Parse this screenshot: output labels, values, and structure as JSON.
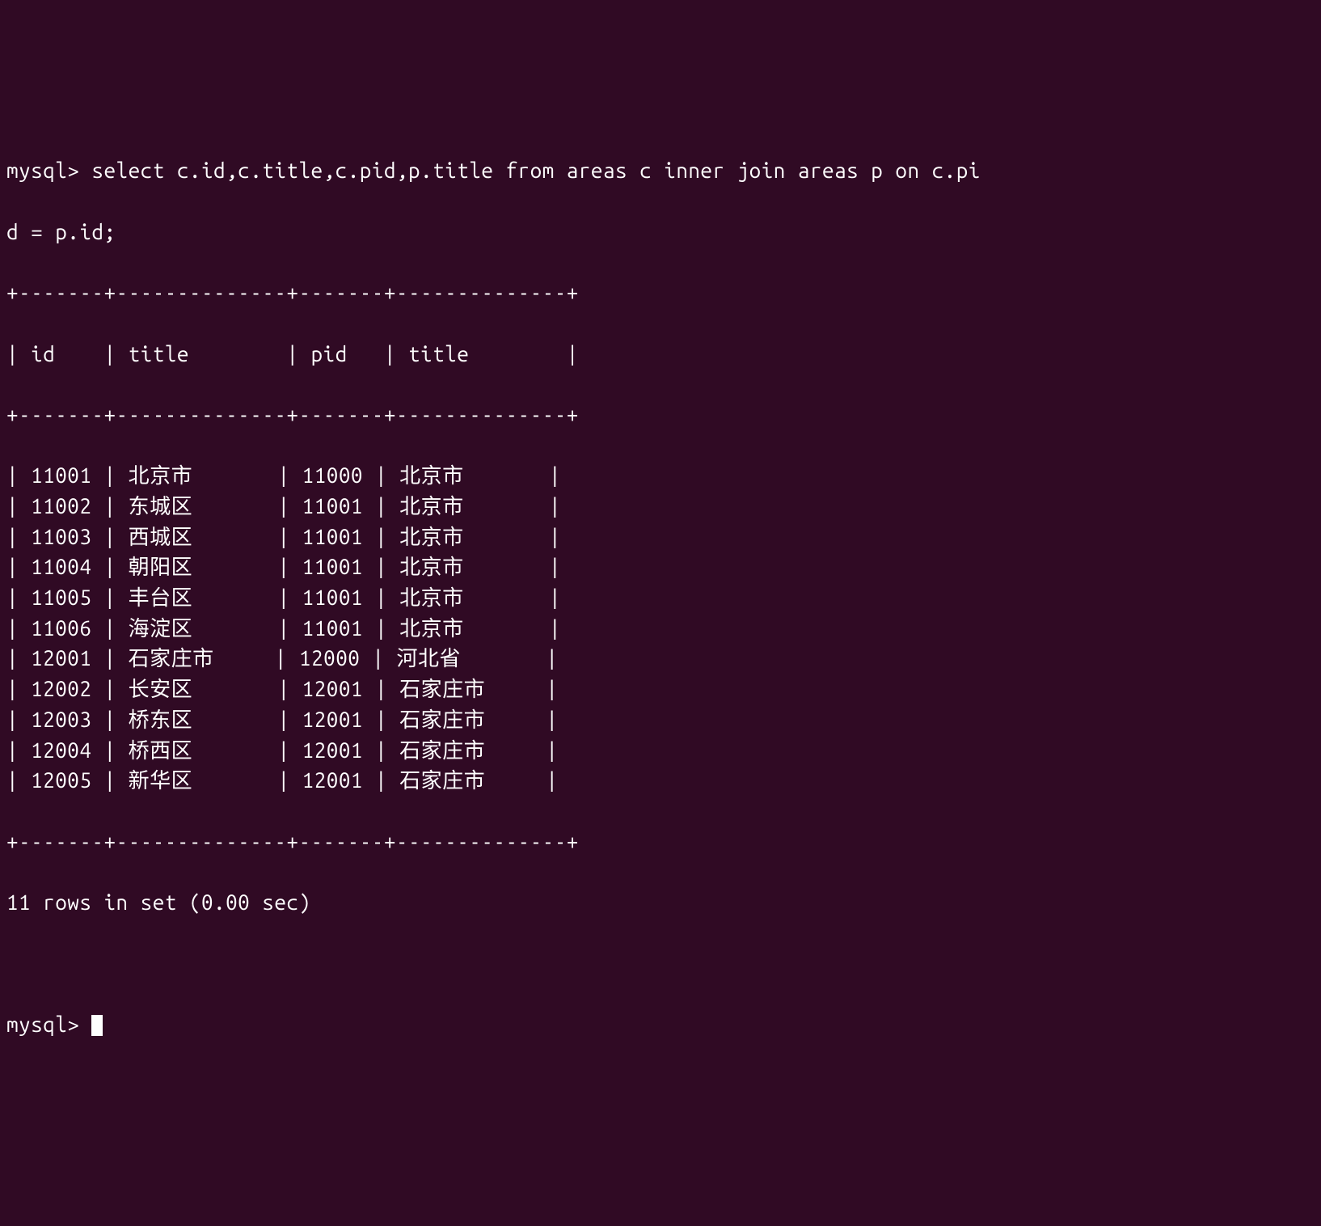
{
  "prompt": {
    "prefix": "mysql>",
    "query_line1": " select c.id,c.title,c.pid,p.title from areas c inner join areas p on c.pi",
    "query_line2": "d = p.id;"
  },
  "table": {
    "top_border": "+-------+--------------+-------+--------------+",
    "header_row": "| id    | title        | pid   | title        |",
    "header_border": "+-------+--------------+-------+--------------+",
    "bottom_border": "+-------+--------------+-------+--------------+",
    "columns": [
      "id",
      "title",
      "pid",
      "title"
    ],
    "rows": [
      {
        "id": "11001",
        "title1": "北京市",
        "pid": "11000",
        "title2": "北京市"
      },
      {
        "id": "11002",
        "title1": "东城区",
        "pid": "11001",
        "title2": "北京市"
      },
      {
        "id": "11003",
        "title1": "西城区",
        "pid": "11001",
        "title2": "北京市"
      },
      {
        "id": "11004",
        "title1": "朝阳区",
        "pid": "11001",
        "title2": "北京市"
      },
      {
        "id": "11005",
        "title1": "丰台区",
        "pid": "11001",
        "title2": "北京市"
      },
      {
        "id": "11006",
        "title1": "海淀区",
        "pid": "11001",
        "title2": "北京市"
      },
      {
        "id": "12001",
        "title1": "石家庄市",
        "pid": "12000",
        "title2": "河北省"
      },
      {
        "id": "12002",
        "title1": "长安区",
        "pid": "12001",
        "title2": "石家庄市"
      },
      {
        "id": "12003",
        "title1": "桥东区",
        "pid": "12001",
        "title2": "石家庄市"
      },
      {
        "id": "12004",
        "title1": "桥西区",
        "pid": "12001",
        "title2": "石家庄市"
      },
      {
        "id": "12005",
        "title1": "新华区",
        "pid": "12001",
        "title2": "石家庄市"
      }
    ],
    "col_widths": {
      "id": 7,
      "title1": 14,
      "pid": 7,
      "title2": 14
    }
  },
  "status": "11 rows in set (0.00 sec)",
  "next_prompt": "mysql> "
}
